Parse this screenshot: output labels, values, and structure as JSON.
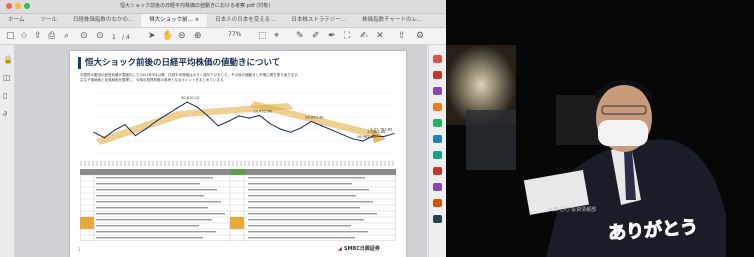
{
  "window": {
    "title": "恒大ショック前後の日経平均株価の値動きにおける考察.pdf (対象)"
  },
  "tabs": [
    {
      "label": "ホーム",
      "active": false
    },
    {
      "label": "ツール",
      "active": false
    },
    {
      "label": "日経株価指数のなかの...",
      "active": false
    },
    {
      "label": "恒大ショック前... ×",
      "active": true
    },
    {
      "label": "日本人の日本を変える...",
      "active": false
    },
    {
      "label": "日本株ストラテジー...",
      "active": false
    },
    {
      "label": "株価指数チャートのレ...",
      "active": false
    }
  ],
  "toolbar": {
    "zoom": "77%",
    "page_current": "1",
    "page_total": "/ 4"
  },
  "document": {
    "title": "恒大ショック前後の日経平均株価の値動きについて",
    "intro": [
      "中国恒大集団の経営危機が表面化した2021年9月以降、日経平均株価は大きく値を下げました。その後の値動きと市場心理を振り返ります。",
      "主な下落局面と反発局面を整理し、今後の投資判断の参考となるポイントをまとめています。"
    ],
    "chart_callouts": [
      "30,670.10",
      "29,452.66",
      "28,893.39",
      "27,581.66",
      "26,962.51",
      "27,783.80"
    ],
    "logo": "SMBC日興証券",
    "page_number": "1"
  },
  "video": {
    "caption": "ありがとう",
    "name_tag": "大西 〇〇 投資情報部"
  },
  "chart_data": {
    "type": "line",
    "title": "",
    "x": [
      1,
      2,
      3,
      4,
      5,
      6,
      7,
      8,
      9,
      10,
      11,
      12,
      13,
      14,
      15,
      16,
      17,
      18,
      19,
      20,
      21,
      22,
      23,
      24,
      25,
      26,
      27,
      28,
      29,
      30
    ],
    "series": [
      {
        "values": [
          27900,
          27400,
          28100,
          28600,
          27600,
          28200,
          28900,
          29500,
          30100,
          30670,
          30200,
          29400,
          28500,
          28900,
          29400,
          29200,
          29452,
          28700,
          28200,
          27900,
          28300,
          28893,
          28500,
          28100,
          27700,
          27300,
          27100,
          27581,
          27500,
          27783
        ]
      }
    ],
    "ylim": [
      26000,
      31500
    ],
    "grid": true
  },
  "colors": {
    "accent": "#1f3a73",
    "arrow": "#e0a93a",
    "line": "#1c2c52",
    "callout": "#c0101e"
  }
}
